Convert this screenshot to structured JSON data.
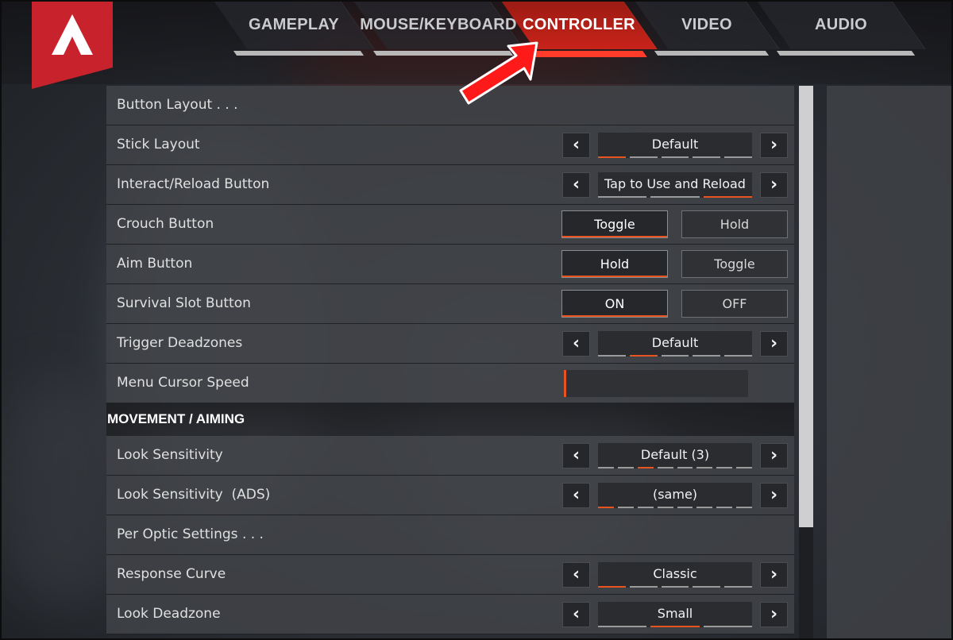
{
  "nav": {
    "tabs": [
      {
        "label": "GAMEPLAY"
      },
      {
        "label": "MOUSE/KEYBOARD"
      },
      {
        "label": "CONTROLLER"
      },
      {
        "label": "VIDEO"
      },
      {
        "label": "AUDIO"
      }
    ],
    "active_tab": "CONTROLLER"
  },
  "settings": {
    "button_layout": "Button Layout . . .",
    "stick_layout": {
      "label": "Stick Layout",
      "value": "Default",
      "options_count": 5,
      "selected_index": 0
    },
    "interact_reload": {
      "label": "Interact/Reload Button",
      "value": "Tap to Use and Reload",
      "options_count": 3,
      "selected_index": 2
    },
    "crouch": {
      "label": "Crouch Button",
      "option_a": "Toggle",
      "option_b": "Hold",
      "selected": "Toggle"
    },
    "aim": {
      "label": "Aim Button",
      "option_a": "Hold",
      "option_b": "Toggle",
      "selected": "Hold"
    },
    "survival_slot": {
      "label": "Survival Slot Button",
      "option_a": "ON",
      "option_b": "OFF",
      "selected": "ON"
    },
    "trigger_deadzones": {
      "label": "Trigger Deadzones",
      "value": "Default",
      "options_count": 5,
      "selected_index": 1
    },
    "menu_cursor_speed": {
      "label": "Menu Cursor Speed",
      "value_fraction": 0.01
    }
  },
  "movement": {
    "section_title": "MOVEMENT / AIMING",
    "look_sensitivity": {
      "label": "Look Sensitivity",
      "value": "Default (3)",
      "options_count": 8,
      "selected_index": 2
    },
    "look_sensitivity_ads": {
      "label": "Look Sensitivity  (ADS)",
      "value": "(same)",
      "options_count": 8,
      "selected_index": 0
    },
    "per_optic": "Per Optic Settings . . .",
    "response_curve": {
      "label": "Response Curve",
      "value": "Classic",
      "options_count": 5,
      "selected_index": 0
    },
    "look_deadzone": {
      "label": "Look Deadzone",
      "value": "Small",
      "options_count": 3,
      "selected_index": 1
    }
  },
  "colors": {
    "accent": "#e8541f",
    "tab_active": "#c8231a",
    "callout": "#ff1a1a"
  },
  "icons": {
    "logo": "apex-logo",
    "arrow_left": "chevron-left-icon",
    "arrow_right": "chevron-right-icon"
  }
}
